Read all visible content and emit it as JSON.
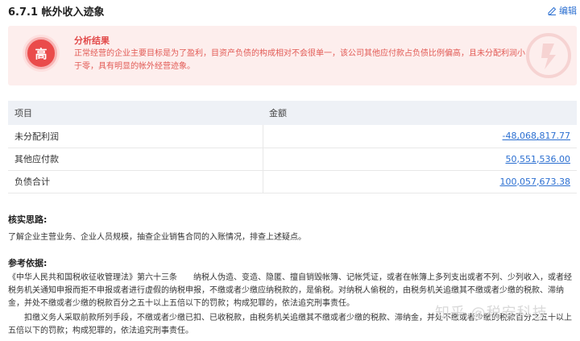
{
  "header": {
    "title": "6.7.1 帐外收入迹象",
    "edit_label": "编辑"
  },
  "alert": {
    "badge": "高",
    "title": "分析结果",
    "text": "正常经营的企业主要目标是为了盈利，目资产负债的构成相对不会很单一，该公司其他应付款占负债比例偏高，且未分配利润小于零，具有明显的帐外经营迹象。"
  },
  "table": {
    "headers": [
      "项目",
      "金额"
    ],
    "rows": [
      {
        "item": "未分配利润",
        "amount": "-48,068,817.77"
      },
      {
        "item": "其他应付款",
        "amount": "50,551,536.00"
      },
      {
        "item": "负债合计",
        "amount": "100,057,673.38"
      }
    ]
  },
  "verify": {
    "title": "核实思路:",
    "text": "了解企业主营业务、企业人员规模，抽查企业销售合同的入账情况，排查上述疑点。"
  },
  "reference": {
    "title": "参考依据:",
    "para1": "《中华人民共和国税收征收管理法》第六十三条　　纳税人伪造、变造、隐匿、擅自销毁帐簿、记帐凭证，或者在帐簿上多列支出或者不列、少列收入，或者经税务机关通知申报而拒不申报或者进行虚假的纳税申报，不缴或者少缴应纳税款的，是偷税。对纳税人偷税的，由税务机关追缴其不缴或者少缴的税款、滞纳金，并处不缴或者少缴的税款百分之五十以上五倍以下的罚款；构成犯罪的，依法追究刑事责任。",
    "para2": "扣缴义务人采取前款所列手段，不缴或者少缴已扣、已收税款，由税务机关追缴其不缴或者少缴的税款、滞纳金，并处不缴或者少缴的税款百分之五十以上五倍以下的罚款；构成犯罪的，依法追究刑事责任。"
  },
  "watermark_text": "知乎 @税安科技"
}
